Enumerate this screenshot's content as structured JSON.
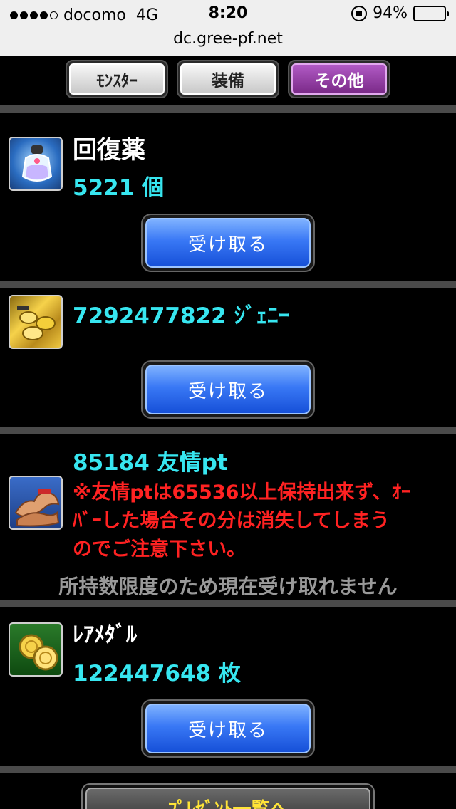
{
  "status_bar": {
    "carrier": "docomo",
    "network": "4G",
    "time": "8:20",
    "battery": "94%",
    "battery_level": 0.94
  },
  "url": "dc.gree-pf.net",
  "tabs": [
    {
      "label": "ﾓﾝｽﾀｰ",
      "active": false
    },
    {
      "label": "装備",
      "active": false
    },
    {
      "label": "その他",
      "active": true
    }
  ],
  "items": [
    {
      "name": "回復薬",
      "count": "5221 個",
      "icon": "potion-icon",
      "button": "受け取る"
    },
    {
      "name": "",
      "count": "7292477822 ｼﾞｪﾆｰ",
      "icon": "gold-pile-icon",
      "button": "受け取る"
    },
    {
      "name": "",
      "count": "85184 友情pt",
      "icon": "friendship-arm-icon",
      "warning_lines": [
        "※友情ptは65536以上保持出来ず、ｵｰ",
        "ﾊﾞｰした場合その分は消失してしまう",
        "のでご注意下さい。"
      ],
      "limit_text": "所持数限度のため現在受け取れません"
    },
    {
      "name": "ﾚｱﾒﾀﾞﾙ",
      "count": "122447648 枚",
      "icon": "rare-medal-icon",
      "button": "受け取る"
    }
  ],
  "present_list_button": "ﾌﾟﾚｾﾞﾝﾄ一覧へ",
  "colors": {
    "count": "#37e6f0",
    "warning": "#ff2222",
    "button_blue": "#3978f5",
    "active_tab": "#9a40ad"
  }
}
